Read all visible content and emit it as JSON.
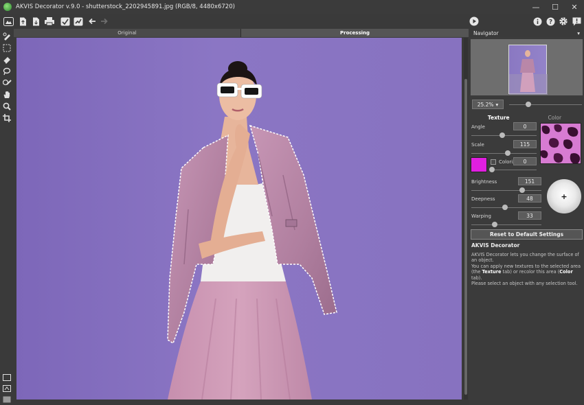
{
  "window": {
    "title": "AKVIS Decorator v.9.0 - shutterstock_2202945891.jpg (RGB/8, 4480x6720)",
    "minimize_glyph": "—",
    "maximize_glyph": "☐",
    "close_glyph": "✕"
  },
  "toolbar": {
    "icons": [
      "workspace-icon",
      "open-icon",
      "save-icon",
      "print-icon",
      "load-preset-icon",
      "save-preset-icon",
      "undo-arrow-icon",
      "redo-arrow-icon",
      "run-icon",
      "about-icon",
      "help-icon",
      "settings-icon",
      "news-icon"
    ]
  },
  "tools": {
    "items": [
      "selection-brush-icon",
      "rect-selection-icon",
      "eraser-icon",
      "lasso-icon",
      "magic-brush-icon",
      "hand-icon",
      "zoom-icon",
      "crop-icon"
    ]
  },
  "tabs": {
    "original": "Original",
    "processing": "Processing"
  },
  "navigator": {
    "title": "Navigator",
    "zoom": "25.2%",
    "zoom_level": 0.4
  },
  "settings": {
    "tab_texture": "Texture",
    "tab_color": "Color",
    "angle_label": "Angle",
    "angle_value": "0",
    "scale_label": "Scale",
    "scale_value": "115",
    "colorize_label": "Colorize",
    "colorize_value": "0",
    "brightness_label": "Brightness",
    "brightness_value": "151",
    "deepness_label": "Deepness",
    "deepness_value": "48",
    "warping_label": "Warping",
    "warping_value": "33",
    "colorize_color": "#e11fe0",
    "reset_label": "Reset to Default Settings"
  },
  "description": {
    "title": "AKVIS Decorator",
    "line1": "AKVIS Decorator lets you change the surface of an object.",
    "line2a": "You can apply new textures to the selected area (the ",
    "texture_word": "Texture",
    "line2b": " tab) or recolor this area (",
    "color_word": "Color",
    "line2c": " tab).",
    "line3": "Please select an object with any selection tool."
  },
  "colors": {
    "background": "#8572c0",
    "panel": "#3b3b3b",
    "jacket": "#b889a8"
  }
}
